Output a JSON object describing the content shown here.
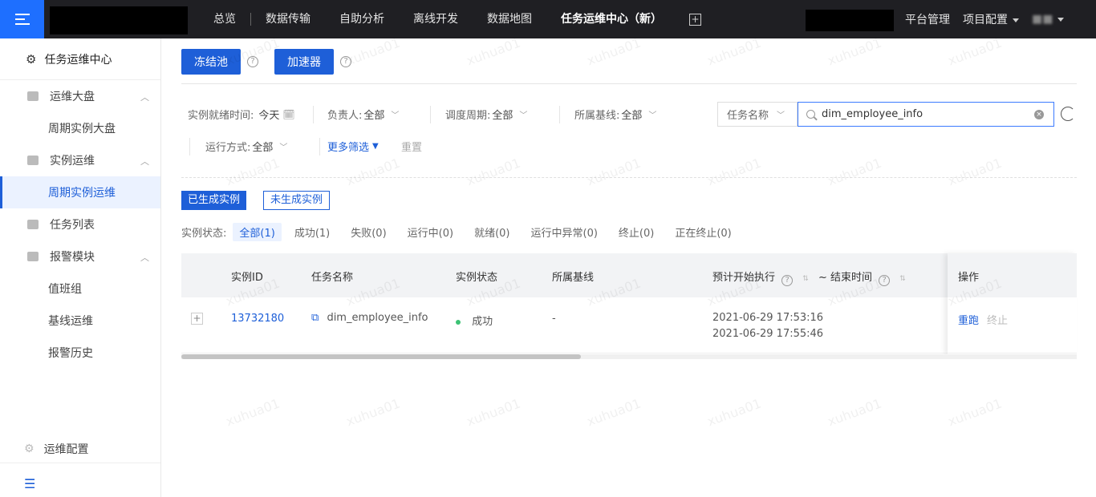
{
  "topbar": {
    "nav": [
      "总览",
      "数据传输",
      "自助分析",
      "离线开发",
      "数据地图",
      "任务运维中心（新）"
    ],
    "plus": "+",
    "right": [
      "平台管理",
      "项目配置"
    ]
  },
  "sidebar": {
    "head": "任务运维中心",
    "groups": [
      {
        "label": "运维大盘",
        "subs": [
          "周期实例大盘"
        ]
      },
      {
        "label": "实例运维",
        "subs": [
          "周期实例运维"
        ]
      },
      {
        "label": "任务列表",
        "subs": []
      },
      {
        "label": "报警模块",
        "subs": [
          "值班组",
          "基线运维",
          "报警历史"
        ]
      }
    ],
    "bottom": "运维配置"
  },
  "toolbar": {
    "freeze": "冻结池",
    "accelerate": "加速器",
    "help": "?"
  },
  "filters": {
    "ready_time_label": "实例就绪时间:",
    "ready_time_value": "今天",
    "owner_label": "负责人:",
    "owner_value": "全部",
    "cycle_label": "调度周期:",
    "cycle_value": "全部",
    "baseline_label": "所属基线:",
    "baseline_value": "全部",
    "run_label": "运行方式:",
    "run_value": "全部",
    "more": "更多筛选",
    "reset": "重置"
  },
  "search": {
    "field": "任务名称",
    "value": "dim_employee_info"
  },
  "tabs": {
    "generated": "已生成实例",
    "not_generated": "未生成实例"
  },
  "status": {
    "label": "实例状态:",
    "items": [
      "全部(1)",
      "成功(1)",
      "失败(0)",
      "运行中(0)",
      "就绪(0)",
      "运行中异常(0)",
      "终止(0)",
      "正在终止(0)"
    ]
  },
  "table": {
    "headers": [
      "实例ID",
      "任务名称",
      "实例状态",
      "所属基线",
      "预计开始执行",
      "~ 结束时间",
      "操作"
    ],
    "rows": [
      {
        "id": "13732180",
        "name": "dim_employee_info",
        "status": "成功",
        "baseline": "-",
        "start": "2021-06-29 17:53:16",
        "end": "2021-06-29 17:55:46",
        "op_rerun": "重跑",
        "op_stop": "终止"
      }
    ]
  },
  "colors": {
    "primary": "#1e5fd8",
    "topbar": "#1f1f23",
    "success": "#3cc274"
  },
  "watermark": "xuhua01"
}
